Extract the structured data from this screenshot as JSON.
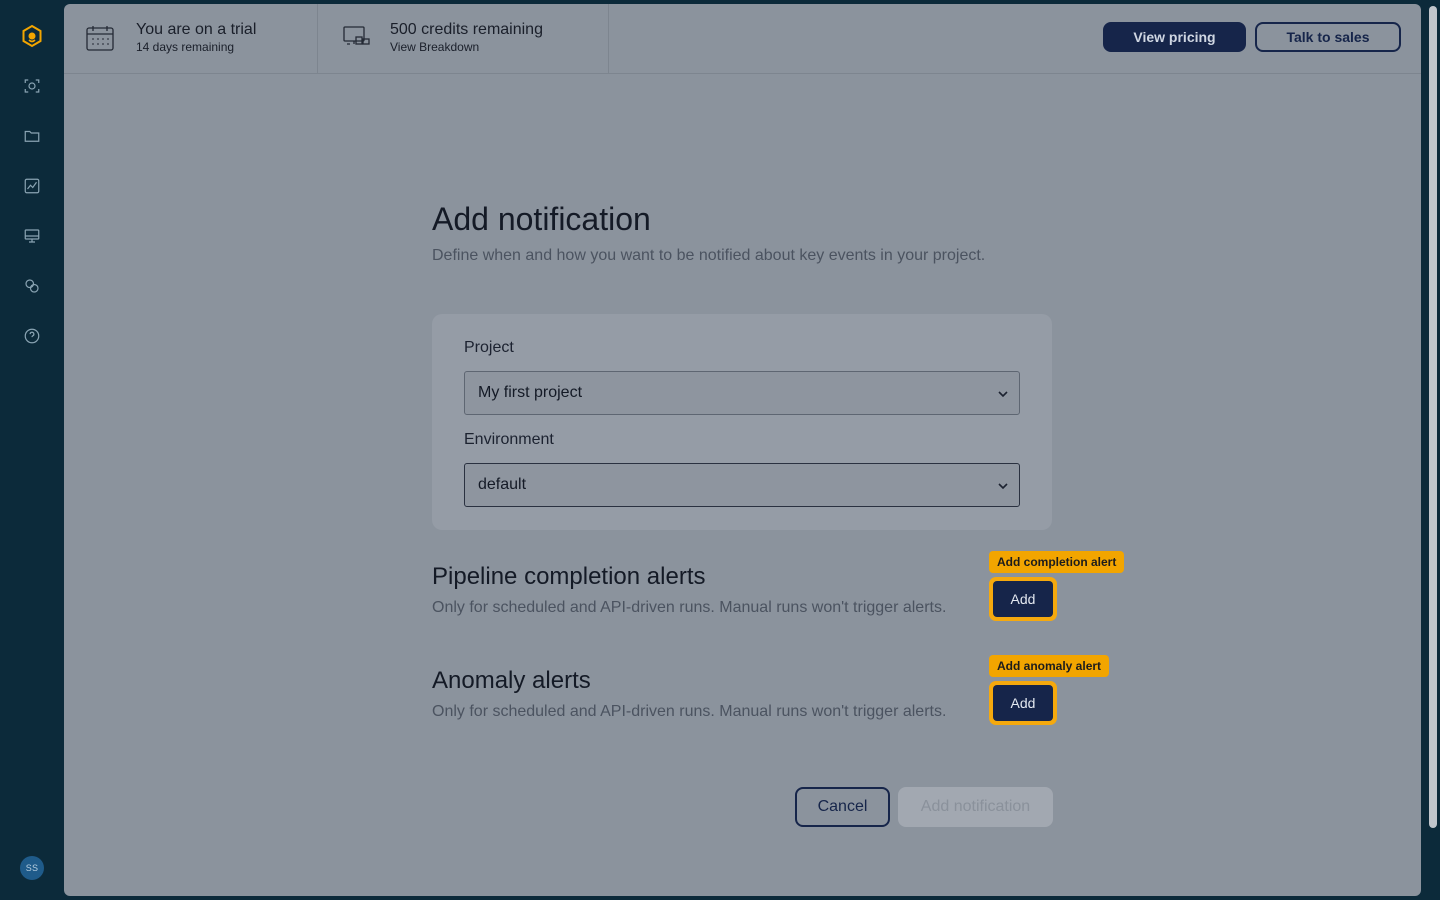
{
  "rail": {
    "icons": [
      "logo-icon",
      "scan-icon",
      "folder-icon",
      "chart-icon",
      "monitor-icon",
      "integrations-icon",
      "help-icon"
    ],
    "avatar_initials": "SS"
  },
  "topbar": {
    "trial_title": "You are on a trial",
    "trial_sub": "14 days remaining",
    "credits_title": "500 credits remaining",
    "credits_sub": "View Breakdown",
    "view_pricing": "View pricing",
    "talk_to_sales": "Talk to sales"
  },
  "page": {
    "title": "Add notification",
    "subtitle": "Define when and how you want to be notified about key events in your project."
  },
  "form": {
    "project_label": "Project",
    "project_value": "My first project",
    "environment_label": "Environment",
    "environment_value": "default"
  },
  "pipeline": {
    "title": "Pipeline completion alerts",
    "desc": "Only for scheduled and API-driven runs. Manual runs won't trigger alerts.",
    "tooltip": "Add completion alert",
    "add_label": "Add"
  },
  "anomaly": {
    "title": "Anomaly alerts",
    "desc": "Only for scheduled and API-driven runs. Manual runs won't trigger alerts.",
    "tooltip": "Add anomaly alert",
    "add_label": "Add"
  },
  "footer": {
    "cancel": "Cancel",
    "add_notification": "Add notification"
  },
  "colors": {
    "rail": "#0c2a3a",
    "accent": "#f2a500",
    "primary": "#16254a"
  }
}
